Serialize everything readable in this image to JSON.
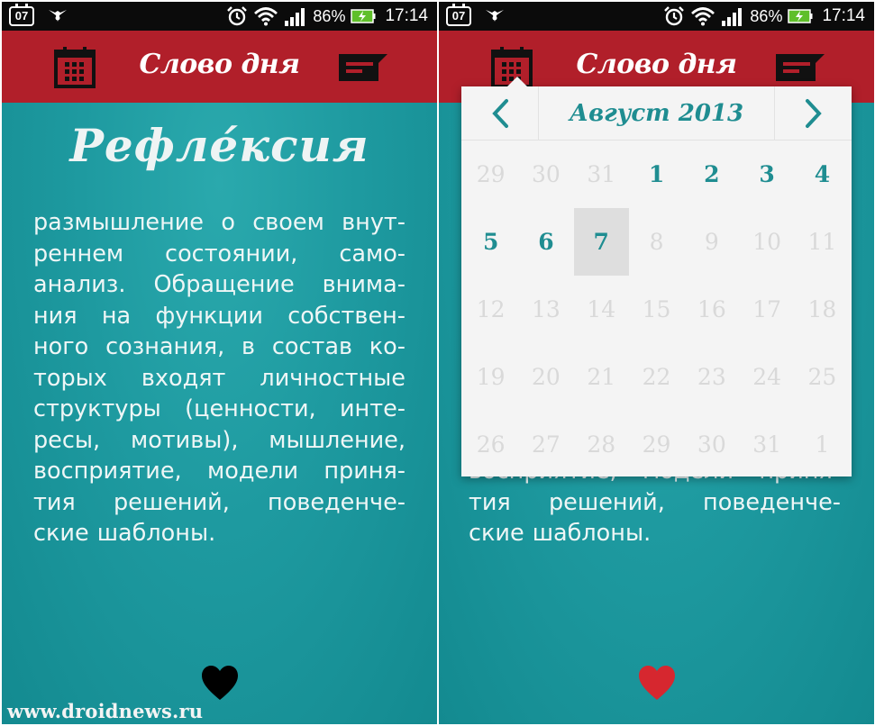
{
  "status_bar": {
    "calendar_day": "07",
    "battery_percent": "86%",
    "time": "17:14",
    "icons": [
      "calendar-notification-icon",
      "bird-icon",
      "alarm-icon",
      "wifi-icon",
      "signal-icon",
      "battery-charging-icon"
    ]
  },
  "app_bar": {
    "title": "Слово дня",
    "left_icon": "calendar-icon",
    "right_icon": "message-icon",
    "color": "#b11f2a"
  },
  "word": {
    "title": "Рефле́ксия",
    "definition_lines": [
      "размышление о своем внут-",
      "реннем состоянии, само-",
      "анализ. Обращение внима-",
      "ния на функции собствен-",
      "ного сознания, в состав ко-",
      "торых входят личностные",
      "структуры (ценности, инте-",
      "ресы, мотивы), мышление,",
      "восприятие, модели приня-",
      "тия решений, поведенче-",
      "ские шаблоны."
    ]
  },
  "favorite": {
    "icon": "heart-icon",
    "left_color": "#000000",
    "right_color": "#d6272f"
  },
  "calendar": {
    "month_label": "Август 2013",
    "prev_icon": "chevron-left-icon",
    "next_icon": "chevron-right-icon",
    "days": [
      {
        "label": "29",
        "state": "muted"
      },
      {
        "label": "30",
        "state": "muted"
      },
      {
        "label": "31",
        "state": "muted"
      },
      {
        "label": "1",
        "state": "active"
      },
      {
        "label": "2",
        "state": "active"
      },
      {
        "label": "3",
        "state": "active"
      },
      {
        "label": "4",
        "state": "active"
      },
      {
        "label": "5",
        "state": "active"
      },
      {
        "label": "6",
        "state": "active"
      },
      {
        "label": "7",
        "state": "selected"
      },
      {
        "label": "8",
        "state": "muted"
      },
      {
        "label": "9",
        "state": "muted"
      },
      {
        "label": "10",
        "state": "muted"
      },
      {
        "label": "11",
        "state": "muted"
      },
      {
        "label": "12",
        "state": "muted"
      },
      {
        "label": "13",
        "state": "muted"
      },
      {
        "label": "14",
        "state": "muted"
      },
      {
        "label": "15",
        "state": "muted"
      },
      {
        "label": "16",
        "state": "muted"
      },
      {
        "label": "17",
        "state": "muted"
      },
      {
        "label": "18",
        "state": "muted"
      },
      {
        "label": "19",
        "state": "muted"
      },
      {
        "label": "20",
        "state": "muted"
      },
      {
        "label": "21",
        "state": "muted"
      },
      {
        "label": "22",
        "state": "muted"
      },
      {
        "label": "23",
        "state": "muted"
      },
      {
        "label": "24",
        "state": "muted"
      },
      {
        "label": "25",
        "state": "muted"
      },
      {
        "label": "26",
        "state": "muted"
      },
      {
        "label": "27",
        "state": "muted"
      },
      {
        "label": "28",
        "state": "muted"
      },
      {
        "label": "29",
        "state": "muted"
      },
      {
        "label": "30",
        "state": "muted"
      },
      {
        "label": "31",
        "state": "muted"
      },
      {
        "label": "1",
        "state": "muted"
      }
    ]
  },
  "watermark": "www.droidnews.ru"
}
